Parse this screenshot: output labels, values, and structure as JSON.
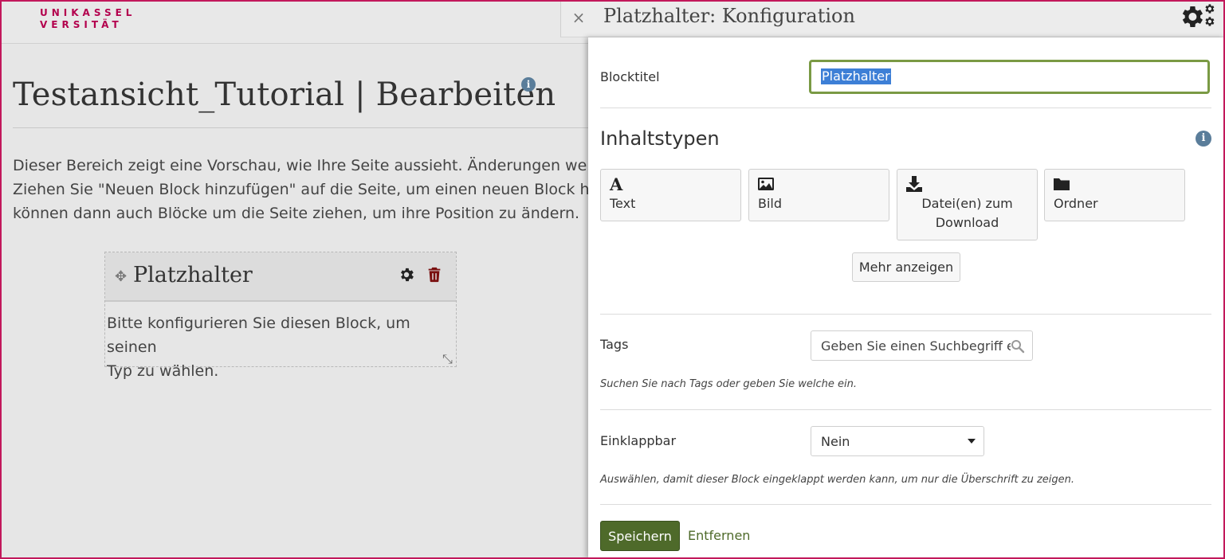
{
  "logo": {
    "line1": "UNIKASSEL",
    "line2": "VERSITÄT"
  },
  "page": {
    "title": "Testansicht_Tutorial | Bearbeiten",
    "info_glyph": "i",
    "intro_lines": [
      "Dieser Bereich zeigt eine Vorschau, wie Ihre Seite aussieht. Änderungen werden a",
      "Ziehen Sie \"Neuen Block hinzufügen\" auf die Seite, um einen neuen Block hinzuzu",
      "können dann auch Blöcke um die Seite ziehen, um ihre Position zu ändern."
    ]
  },
  "block": {
    "title": "Platzhalter",
    "body_lines": [
      "Bitte konfigurieren Sie diesen Block, um seinen",
      "Typ zu wählen."
    ],
    "move_glyph": "✥",
    "resize_glyph": "⤡"
  },
  "drawer": {
    "close_glyph": "×",
    "title": "Platzhalter: Konfiguration",
    "blocktitle_label": "Blocktitel",
    "blocktitle_value": "Platzhalter",
    "content_types_heading": "Inhaltstypen",
    "content_types": [
      {
        "icon": "text-icon",
        "label": "Text"
      },
      {
        "icon": "image-icon",
        "label": "Bild"
      },
      {
        "icon": "download-icon",
        "label_line1": "Datei(en) zum",
        "label_line2": "Download"
      },
      {
        "icon": "folder-icon",
        "label": "Ordner"
      }
    ],
    "more_button": "Mehr anzeigen",
    "tags_label": "Tags",
    "tags_placeholder": "Geben Sie einen Suchbegriff ein",
    "tags_hint": "Suchen Sie nach Tags oder geben Sie welche ein.",
    "collapsible_label": "Einklappbar",
    "collapsible_value": "Nein",
    "collapsible_hint": "Auswählen, damit dieser Block eingeklappt werden kann, um nur die Überschrift zu zeigen.",
    "save_button": "Speichern",
    "remove_link": "Entfernen"
  },
  "colors": {
    "brand": "#b3004d",
    "accent_green": "#4e6a2a",
    "focus_border": "#7a9a44",
    "info_blue": "#5a7d9a",
    "selection": "#3d7fd6"
  }
}
